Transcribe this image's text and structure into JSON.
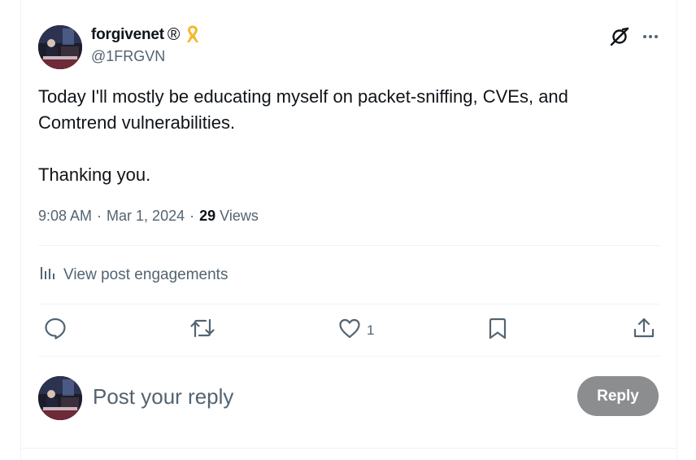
{
  "author": {
    "display_name": "forgivenet",
    "registered_mark": "®",
    "badge_icon": "ribbon-icon",
    "handle": "@1FRGVN"
  },
  "post": {
    "text": "Today I'll mostly be educating myself on packet-sniffing, CVEs, and\nComtrend vulnerabilities.\n\nThanking you.",
    "time": "9:08 AM",
    "separator": "·",
    "date": "Mar 1, 2024",
    "views_count": "29",
    "views_label": "Views"
  },
  "engagements": {
    "label": "View post engagements",
    "icon": "analytics-icon"
  },
  "actions": {
    "reply_icon": "comment-icon",
    "repost_icon": "repost-icon",
    "like_icon": "heart-icon",
    "like_count": "1",
    "bookmark_icon": "bookmark-icon",
    "share_icon": "share-icon"
  },
  "reply_box": {
    "placeholder": "Post your reply",
    "button_label": "Reply"
  },
  "colors": {
    "text_primary": "#0f1419",
    "text_secondary": "#536471",
    "divider": "#eff3f4",
    "reply_button_disabled": "#8b8d8f",
    "ribbon": "#f4b82e"
  }
}
